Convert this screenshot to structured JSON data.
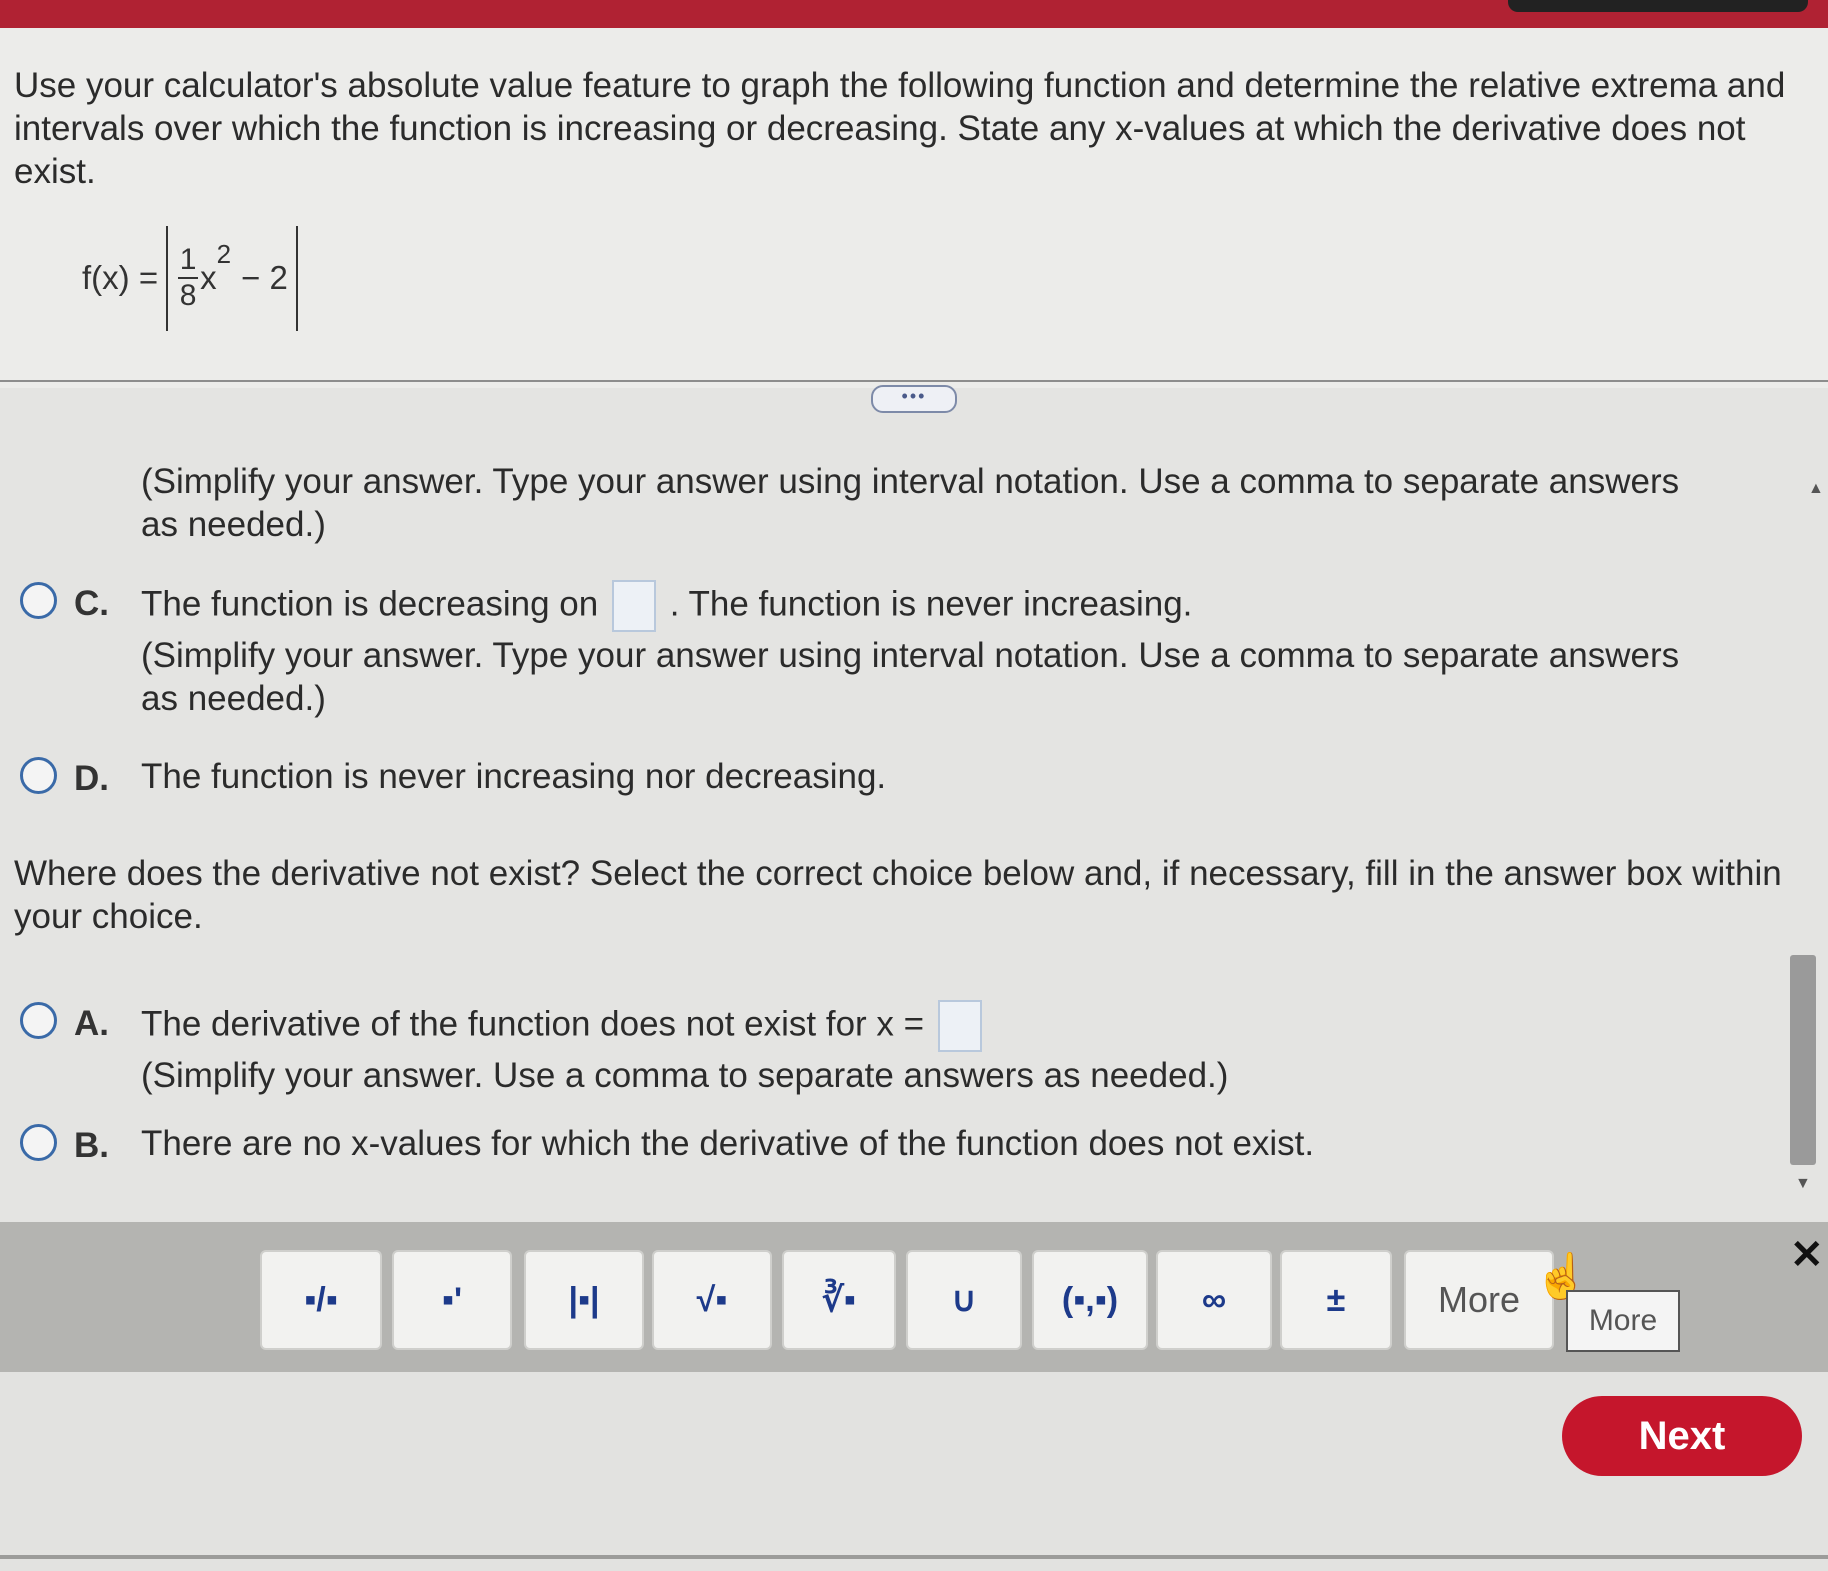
{
  "question": {
    "text": "Use your calculator's absolute value feature to graph the following function and determine the relative extrema and intervals over which the function is increasing or decreasing. State any x-values at which the derivative does not exist.",
    "formula": {
      "lhs": "f(x) =",
      "numerator": "1",
      "denominator": "8",
      "variable": "x",
      "exponent": "2",
      "tail": "− 2"
    }
  },
  "expand_label": "•••",
  "part_increase": {
    "hint_b": "(Simplify your answer. Type your answer using interval notation. Use a comma to separate answers",
    "hint_b2": "as needed.)",
    "choice_c": {
      "letter": "C.",
      "text_before": "The function is decreasing on",
      "text_after": ". The function is never increasing.",
      "hint1": "(Simplify your answer. Type your answer using interval notation. Use a comma to separate answers",
      "hint2": "as needed.)"
    },
    "choice_d": {
      "letter": "D.",
      "text": "The function is never increasing nor decreasing."
    }
  },
  "part_derivative": {
    "question": "Where does the derivative not exist? Select the correct choice below and, if necessary, fill in the answer box within",
    "question2": "your choice.",
    "choice_a": {
      "letter": "A.",
      "text": "The derivative of the function does not exist for x =",
      "hint": "(Simplify your answer. Use a comma to separate answers as needed.)"
    },
    "choice_b": {
      "letter": "B.",
      "text": "There are no x-values for which the derivative of the function does not exist."
    }
  },
  "toolbar": {
    "tools": [
      "▪/▪",
      "▪'",
      "|▪|",
      "√▪",
      "∛▪",
      "∪",
      "(▪,▪)",
      "∞",
      "±"
    ],
    "more_label": "More",
    "tooltip": "More"
  },
  "close_symbol": "✕",
  "next_label": "Next",
  "colors": {
    "brand_red": "#c5162c",
    "radio_blue": "#3a6aa8",
    "tool_blue": "#1d3a8a"
  }
}
